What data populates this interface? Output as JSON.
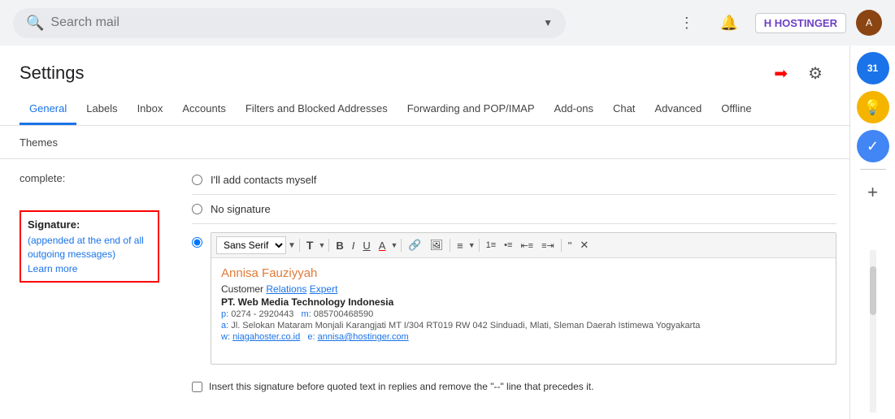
{
  "topbar": {
    "search_placeholder": "Search mail",
    "dropdown_icon": "▼",
    "apps_icon": "⋮⋮⋮",
    "bell_icon": "🔔",
    "hostinger_label": "HOSTINGER",
    "hostinger_icon": "H"
  },
  "settings": {
    "title": "Settings",
    "gear_icon": "⚙",
    "tabs": [
      {
        "label": "General",
        "active": true
      },
      {
        "label": "Labels",
        "active": false
      },
      {
        "label": "Inbox",
        "active": false
      },
      {
        "label": "Accounts",
        "active": false
      },
      {
        "label": "Filters and Blocked Addresses",
        "active": false
      },
      {
        "label": "Forwarding and POP/IMAP",
        "active": false
      },
      {
        "label": "Add-ons",
        "active": false
      },
      {
        "label": "Chat",
        "active": false
      },
      {
        "label": "Advanced",
        "active": false
      },
      {
        "label": "Offline",
        "active": false
      }
    ],
    "themes_label": "Themes",
    "complete_label": "complete:",
    "signature": {
      "title": "Signature:",
      "description": "(appended at the end of all outgoing messages)",
      "learn_more": "Learn more",
      "options": [
        {
          "label": "I'll add contacts myself",
          "selected": false
        },
        {
          "label": "No signature",
          "selected": false
        }
      ],
      "selected_option": "custom",
      "toolbar": {
        "font": "Sans Serif",
        "font_size_icon": "T↕",
        "bold": "B",
        "italic": "I",
        "underline": "U",
        "font_color": "A",
        "link": "🔗",
        "image": "🖼",
        "align": "≡",
        "ordered_list": "1≡",
        "bullet_list": "•≡",
        "indent_left": "⇤≡",
        "indent_right": "≡⇥",
        "quote": "❝",
        "clear": "✕"
      },
      "sig_name": "Annisa Fauziyyah",
      "sig_job_title": "Customer",
      "sig_job_title_relations": "Relations",
      "sig_job_title_expert": "Expert",
      "sig_company": "PT. Web Media Technology Indonesia",
      "sig_phone_label": "p:",
      "sig_phone": "0274 - 2920443",
      "sig_mobile_label": "m:",
      "sig_mobile": "085700468590",
      "sig_address_label": "a:",
      "sig_address": "Jl. Selokan Mataram Monjali Karangjati MT I/304 RT019 RW 042 Sinduadi, Mlati, Sleman Daerah Istimewa Yogyakarta",
      "sig_web_label": "w:",
      "sig_web_url": "niagahoster.co.id",
      "sig_email_label": "e:",
      "sig_email": "annisa@hostinger.com",
      "insert_sig_text": "Insert this signature before quoted text in replies and remove the \"--\" line that precedes it."
    }
  },
  "right_sidebar": {
    "calendar_label": "31",
    "bulb_label": "💡",
    "tasks_label": "✓",
    "plus_label": "+"
  }
}
